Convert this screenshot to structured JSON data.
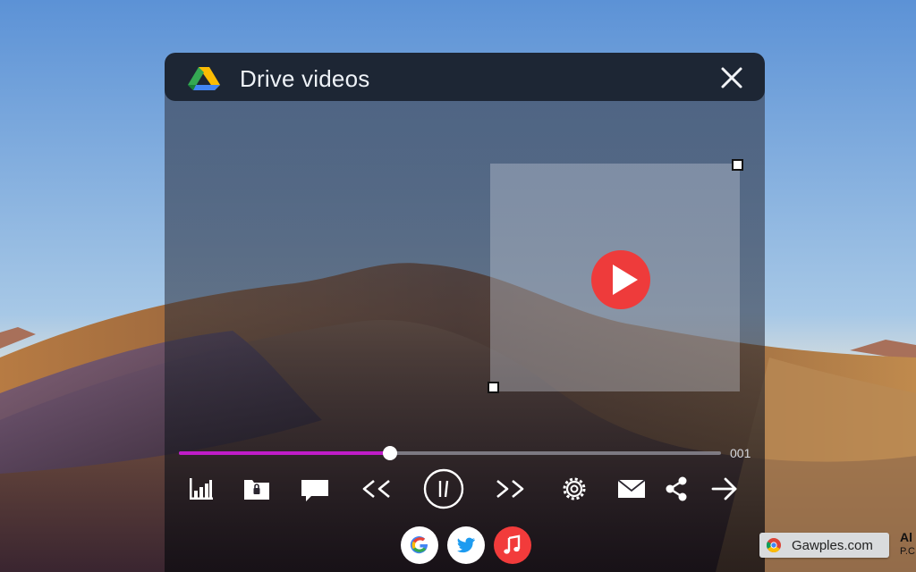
{
  "window": {
    "title": "Drive videos",
    "app_icon": "google-drive-icon",
    "close_icon": "close-icon"
  },
  "player": {
    "progress_fraction": 0.39,
    "time_label": "001",
    "overlay_icon": "play-icon",
    "accent_color": "#c01cc8",
    "play_color": "#ee3b3b"
  },
  "controls": [
    {
      "name": "stats-icon"
    },
    {
      "name": "folder-lock-icon"
    },
    {
      "name": "comment-icon"
    },
    {
      "name": "rewind-icon"
    },
    {
      "name": "pause-icon"
    },
    {
      "name": "fast-forward-icon"
    },
    {
      "name": "settings-gear-icon"
    },
    {
      "name": "email-icon"
    },
    {
      "name": "share-icon"
    },
    {
      "name": "arrow-right-icon"
    }
  ],
  "share_targets": [
    {
      "name": "google-share-button",
      "icon": "google-icon"
    },
    {
      "name": "twitter-share-button",
      "icon": "twitter-icon"
    },
    {
      "name": "music-share-button",
      "icon": "music-icon"
    }
  ],
  "taskbar": {
    "url": "Gawples.com",
    "clock_line1": "Al",
    "clock_line2": "P.C"
  }
}
